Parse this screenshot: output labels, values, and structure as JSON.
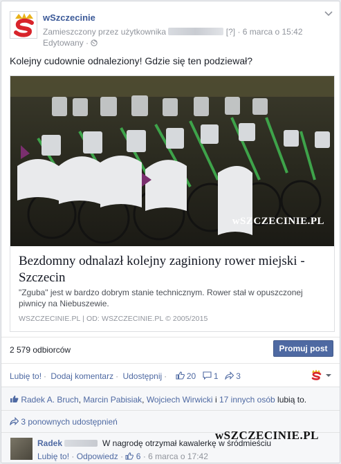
{
  "header": {
    "page_name": "wSzczecinie",
    "posted_by": "Zamieszczony przez użytkownika",
    "help_marker": "[?]",
    "date": "6 marca o 15:42",
    "edited": "Edytowany"
  },
  "post": {
    "text": "Kolejny cudownie odnaleziony! Gdzie się ten podziewał?"
  },
  "link": {
    "watermark": "wSZCZECINIE.PL",
    "title": "Bezdomny odnalazł kolejny zaginiony rower miejski - Szczecin",
    "description": "\"Zguba\" jest w bardzo dobrym stanie technicznym. Rower stał w opuszczonej piwnicy na Niebuszewie.",
    "source": "WSZCZECINIE.PL   |   OD: WSZCZECINIE.PL © 2005/2015"
  },
  "stats": {
    "reach": "2 579 odbiorców",
    "promote_label": "Promuj post"
  },
  "actions": {
    "like": "Lubię to!",
    "comment": "Dodaj komentarz",
    "share": "Udostępnij",
    "like_count": "20",
    "comment_count": "1",
    "share_count": "3"
  },
  "ufi": {
    "likers": [
      "Radek A. Bruch",
      "Marcin Pabisiak",
      "Wojciech Wirwicki"
    ],
    "others": "17 innych osób",
    "likes_suffix": "lubią to.",
    "and": "i",
    "sep": ",",
    "shares": "3 ponownych udostępnień"
  },
  "comment": {
    "author": "Radek",
    "text": "W nagrodę otrzymał kawalerkę w śródmieściu",
    "like": "Lubię to!",
    "reply": "Odpowiedz",
    "likes": "6",
    "date": "6 marca o 17:42"
  },
  "overlay_watermark": "wSZCZECINIE.PL",
  "colors": {
    "link": "#3b5998",
    "button": "#4e69a2",
    "logo_red": "#d8242b",
    "logo_gold": "#e8b21a"
  }
}
